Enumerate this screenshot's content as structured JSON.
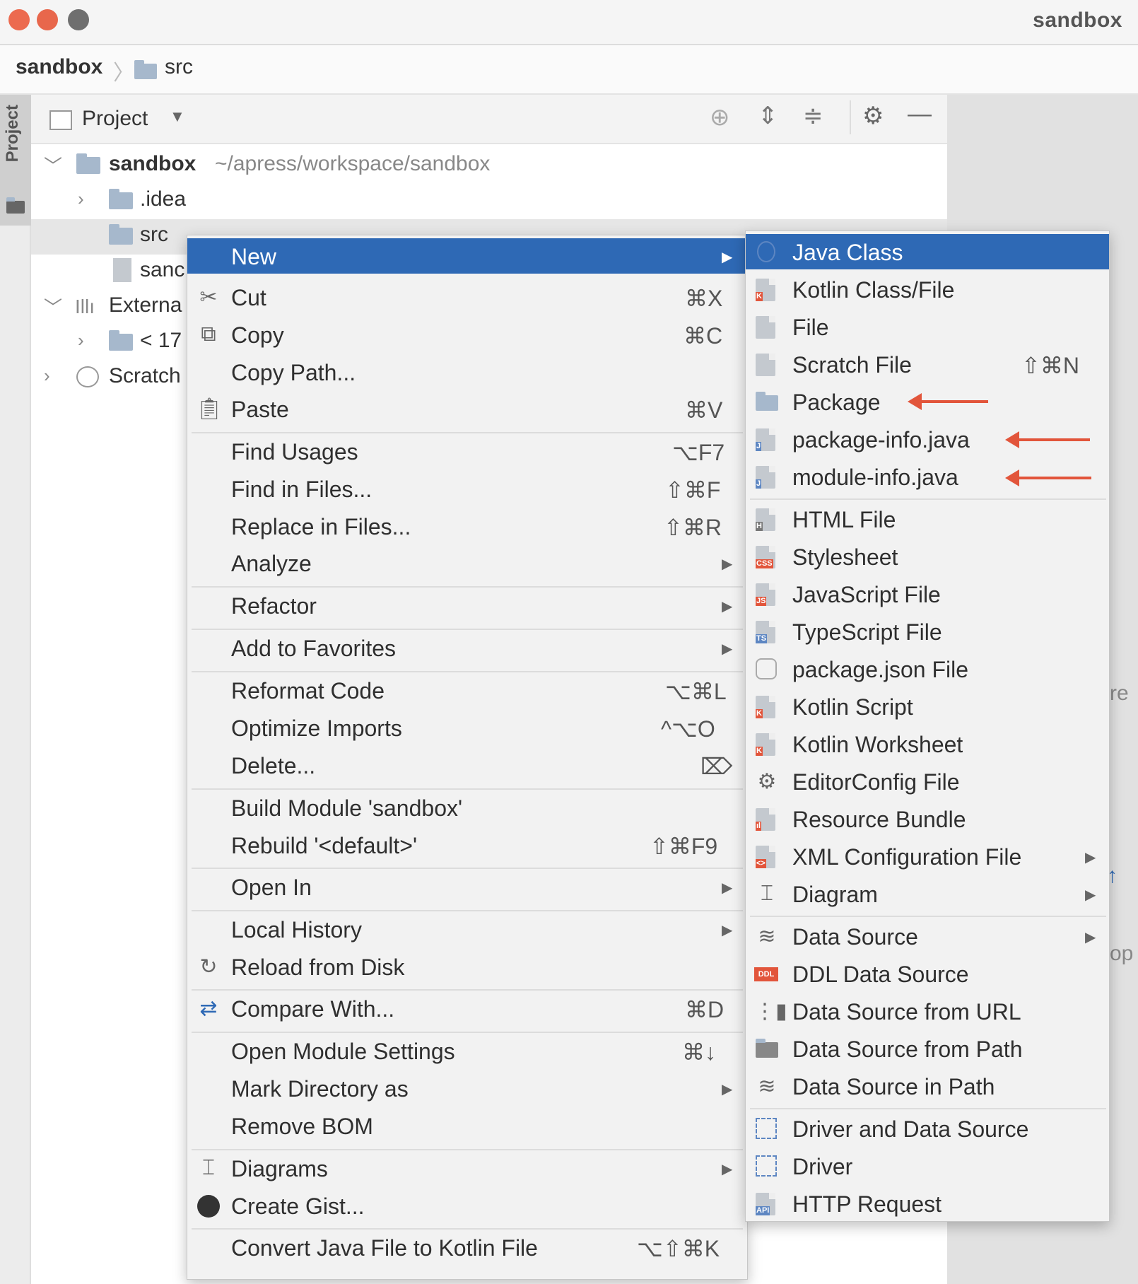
{
  "window": {
    "title": "sandbox",
    "traffic_lights": [
      "#ec6a4f",
      "#e8674c",
      "#6f6f6f"
    ]
  },
  "breadcrumb": {
    "root": "sandbox",
    "child": "src"
  },
  "sidebar": {
    "tab_label": "Project"
  },
  "project_panel": {
    "title": "Project",
    "tools": [
      "locate-icon",
      "expand-all-icon",
      "collapse-all-icon",
      "gear-icon",
      "minimize-icon"
    ]
  },
  "tree": {
    "root_name": "sandbox",
    "root_path": "~/apress/workspace/sandbox",
    "idea": ".idea",
    "src": "src",
    "sandbox_file": "sanc",
    "external": "Externa",
    "jdk": "< 17",
    "scratches": "Scratch"
  },
  "context_menu": {
    "new": "New",
    "cut": "Cut",
    "cut_sc": "⌘X",
    "copy": "Copy",
    "copy_sc": "⌘C",
    "copy_path": "Copy Path...",
    "paste": "Paste",
    "paste_sc": "⌘V",
    "find_usages": "Find Usages",
    "find_usages_sc": "⌥F7",
    "find_in_files": "Find in Files...",
    "find_in_files_sc": "⇧⌘F",
    "replace_in_files": "Replace in Files...",
    "replace_in_files_sc": "⇧⌘R",
    "analyze": "Analyze",
    "refactor": "Refactor",
    "add_to_favorites": "Add to Favorites",
    "reformat": "Reformat Code",
    "reformat_sc": "⌥⌘L",
    "optimize": "Optimize Imports",
    "optimize_sc": "^⌥O",
    "delete": "Delete...",
    "delete_sc": "⌦",
    "build": "Build Module 'sandbox'",
    "rebuild": "Rebuild '<default>'",
    "rebuild_sc": "⇧⌘F9",
    "open_in": "Open In",
    "local_history": "Local History",
    "reload": "Reload from Disk",
    "compare": "Compare With...",
    "compare_sc": "⌘D",
    "module_settings": "Open Module Settings",
    "module_settings_sc": "⌘↓",
    "mark_dir": "Mark Directory as",
    "remove_bom": "Remove BOM",
    "diagrams": "Diagrams",
    "create_gist": "Create Gist...",
    "convert": "Convert Java File to Kotlin File",
    "convert_sc": "⌥⇧⌘K"
  },
  "new_submenu": {
    "java_class": "Java Class",
    "kotlin_class": "Kotlin Class/File",
    "file": "File",
    "scratch": "Scratch File",
    "scratch_sc": "⇧⌘N",
    "package": "Package",
    "package_info": "package-info.java",
    "module_info": "module-info.java",
    "html": "HTML File",
    "stylesheet": "Stylesheet",
    "javascript": "JavaScript File",
    "typescript": "TypeScript File",
    "package_json": "package.json File",
    "kotlin_script": "Kotlin Script",
    "kotlin_worksheet": "Kotlin Worksheet",
    "editorconfig": "EditorConfig File",
    "resource_bundle": "Resource Bundle",
    "xml_config": "XML Configuration File",
    "diagram": "Diagram",
    "data_source": "Data Source",
    "ddl_data_source": "DDL Data Source",
    "ds_url": "Data Source from URL",
    "ds_path": "Data Source from Path",
    "ds_in_path": "Data Source in Path",
    "driver_ds": "Driver and Data Source",
    "driver": "Driver",
    "http_request": "HTTP Request"
  },
  "badges": {
    "java": "J",
    "html": "H",
    "css": "CSS",
    "js": "JS",
    "ts": "TS",
    "ddl": "DDL",
    "api": "API",
    "xml": "<>"
  },
  "colors": {
    "highlight": "#2e69b5",
    "annotation_arrow": "#e2553b"
  },
  "edge_fragments": {
    "a": "re",
    "b": "op",
    "c": "↑"
  }
}
